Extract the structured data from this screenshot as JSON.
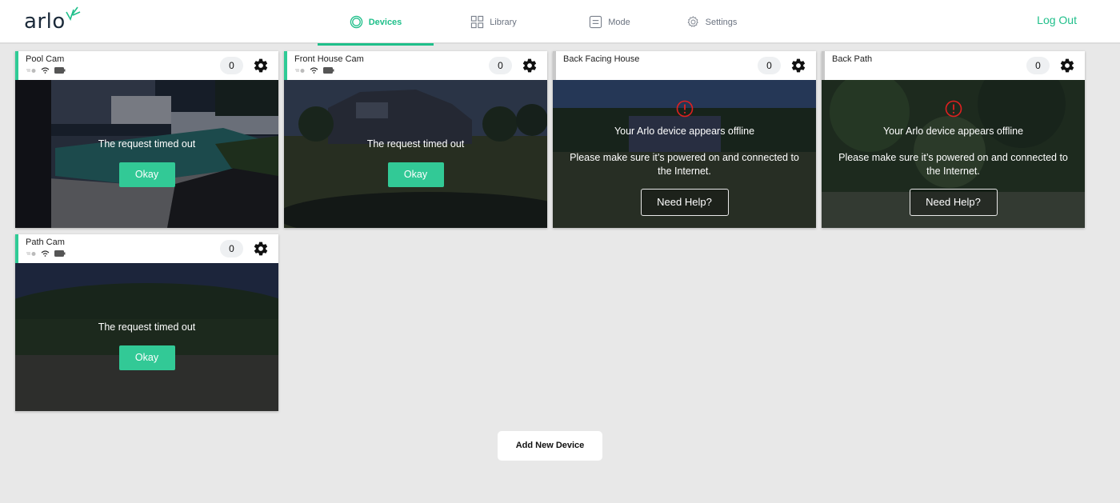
{
  "app": {
    "logo_text": "arlo"
  },
  "nav": {
    "items": [
      {
        "label": "Devices",
        "icon": "devices-icon",
        "active": true
      },
      {
        "label": "Library",
        "icon": "library-grid-icon",
        "active": false
      },
      {
        "label": "Mode",
        "icon": "mode-icon",
        "active": false
      },
      {
        "label": "Settings",
        "icon": "gear-outline-icon",
        "active": false
      }
    ],
    "logout_label": "Log Out"
  },
  "colors": {
    "accent": "#1fbf8a",
    "button": "#32c996",
    "alert": "#e02020",
    "offline_border": "#c8c8c8"
  },
  "devices": [
    {
      "name": "Pool Cam",
      "count": "0",
      "status": "timeout",
      "message": "The request timed out",
      "button": "Okay",
      "show_status_icons": true
    },
    {
      "name": "Front House Cam",
      "count": "0",
      "status": "timeout",
      "message": "The request timed out",
      "button": "Okay",
      "show_status_icons": true
    },
    {
      "name": "Back Facing House",
      "count": "0",
      "status": "offline",
      "message": "Your Arlo device appears offline",
      "detail": "Please make sure it’s powered on and connected to the Internet.",
      "button": "Need Help?",
      "show_status_icons": false
    },
    {
      "name": "Back Path",
      "count": "0",
      "status": "offline",
      "message": "Your Arlo device appears offline",
      "detail": "Please make sure it’s powered on and connected to the Internet.",
      "button": "Need Help?",
      "show_status_icons": false
    },
    {
      "name": "Path Cam",
      "count": "0",
      "status": "timeout",
      "message": "The request timed out",
      "button": "Okay",
      "show_status_icons": true
    }
  ],
  "add_device_label": "Add New Device"
}
